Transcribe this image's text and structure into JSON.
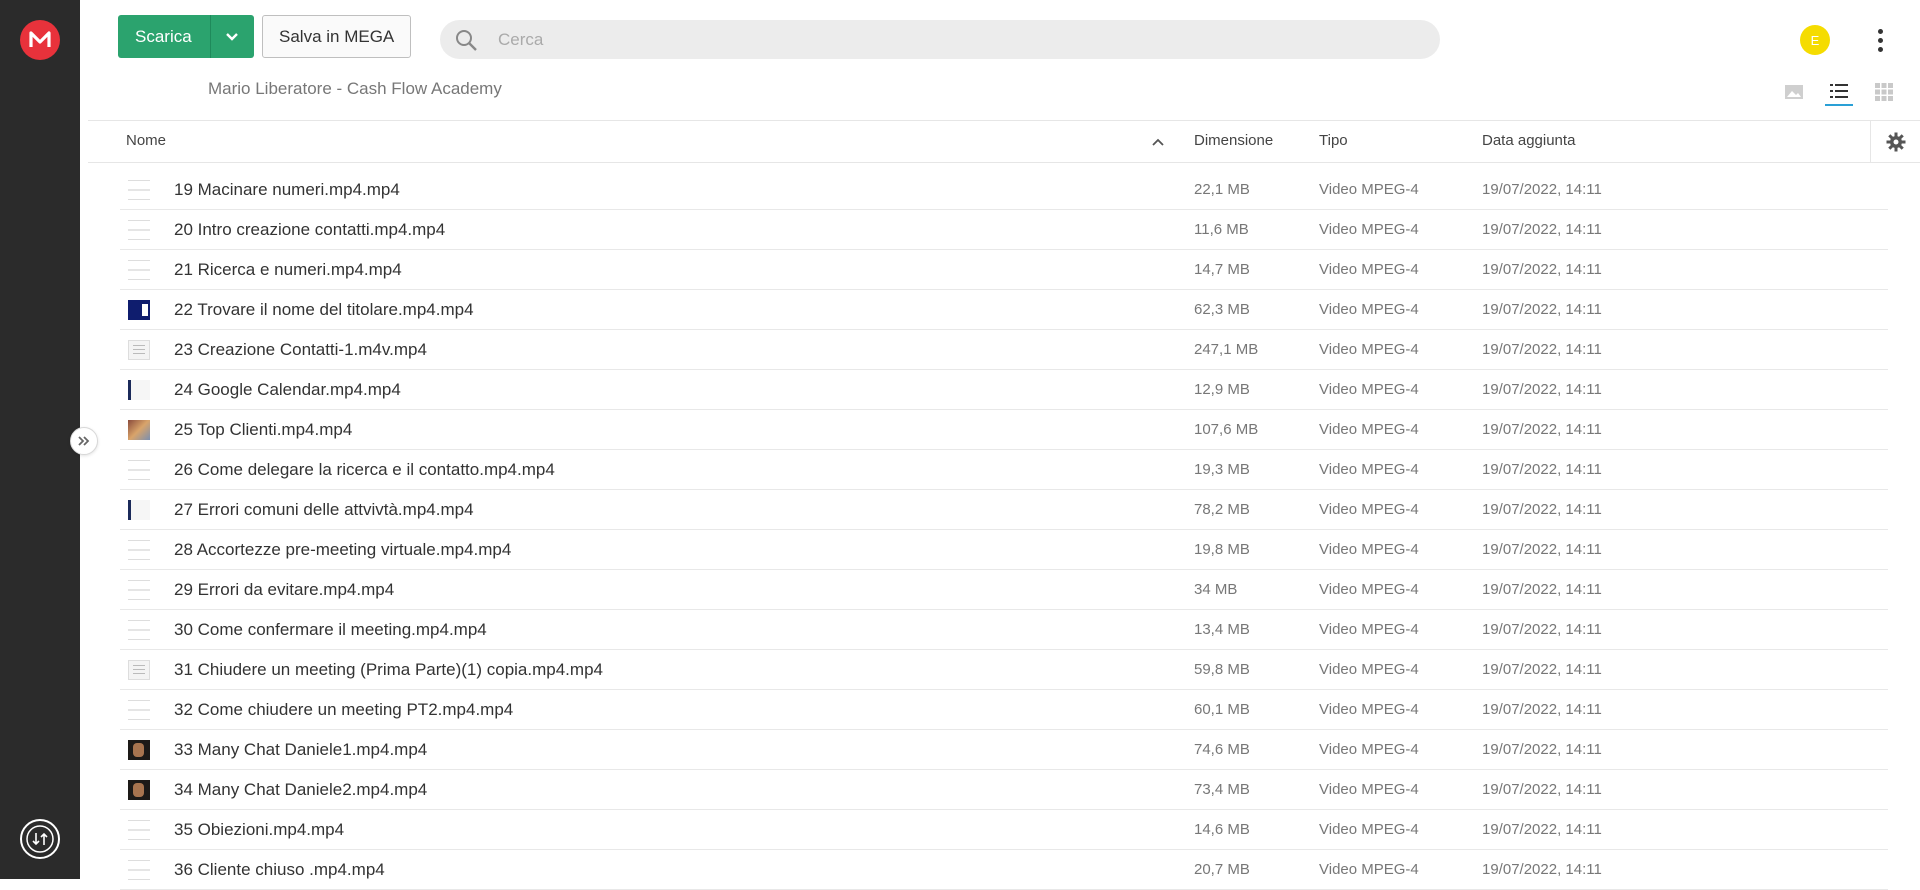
{
  "toolbar": {
    "download_label": "Scarica",
    "save_label": "Salva in MEGA",
    "search_placeholder": "Cerca",
    "avatar_initial": "E"
  },
  "breadcrumb": "Mario Liberatore - Cash Flow Academy",
  "columns": {
    "name": "Nome",
    "size": "Dimensione",
    "type": "Tipo",
    "date": "Data aggiunta"
  },
  "colors": {
    "download_button": "#2ba36e",
    "logo": "#e8323b",
    "avatar": "#f5dc00",
    "sidebar": "#2b2b2b"
  },
  "files": [
    {
      "name": "19 Macinare numeri.mp4.mp4",
      "size": "22,1 MB",
      "type": "Video MPEG-4",
      "date": "19/07/2022, 14:11",
      "thumb": "t-blank"
    },
    {
      "name": "20 Intro creazione contatti.mp4.mp4",
      "size": "11,6 MB",
      "type": "Video MPEG-4",
      "date": "19/07/2022, 14:11",
      "thumb": "t-blank"
    },
    {
      "name": "21 Ricerca e numeri.mp4.mp4",
      "size": "14,7 MB",
      "type": "Video MPEG-4",
      "date": "19/07/2022, 14:11",
      "thumb": "t-blank"
    },
    {
      "name": "22 Trovare il nome del titolare.mp4.mp4",
      "size": "62,3 MB",
      "type": "Video MPEG-4",
      "date": "19/07/2022, 14:11",
      "thumb": "t-navy"
    },
    {
      "name": "23 Creazione Contatti-1.m4v.mp4",
      "size": "247,1 MB",
      "type": "Video MPEG-4",
      "date": "19/07/2022, 14:11",
      "thumb": "t-doc"
    },
    {
      "name": "24 Google Calendar.mp4.mp4",
      "size": "12,9 MB",
      "type": "Video MPEG-4",
      "date": "19/07/2022, 14:11",
      "thumb": "t-bar"
    },
    {
      "name": "25 Top Clienti.mp4.mp4",
      "size": "107,6 MB",
      "type": "Video MPEG-4",
      "date": "19/07/2022, 14:11",
      "thumb": "t-color"
    },
    {
      "name": "26 Come delegare la ricerca e il contatto.mp4.mp4",
      "size": "19,3 MB",
      "type": "Video MPEG-4",
      "date": "19/07/2022, 14:11",
      "thumb": "t-blank"
    },
    {
      "name": "27 Errori comuni delle attvivtà.mp4.mp4",
      "size": "78,2 MB",
      "type": "Video MPEG-4",
      "date": "19/07/2022, 14:11",
      "thumb": "t-bar"
    },
    {
      "name": "28 Accortezze pre-meeting virtuale.mp4.mp4",
      "size": "19,8 MB",
      "type": "Video MPEG-4",
      "date": "19/07/2022, 14:11",
      "thumb": "t-blank"
    },
    {
      "name": "29 Errori da evitare.mp4.mp4",
      "size": "34 MB",
      "type": "Video MPEG-4",
      "date": "19/07/2022, 14:11",
      "thumb": "t-blank"
    },
    {
      "name": "30 Come confermare il meeting.mp4.mp4",
      "size": "13,4 MB",
      "type": "Video MPEG-4",
      "date": "19/07/2022, 14:11",
      "thumb": "t-blank"
    },
    {
      "name": "31 Chiudere un meeting (Prima Parte)(1) copia.mp4.mp4",
      "size": "59,8 MB",
      "type": "Video MPEG-4",
      "date": "19/07/2022, 14:11",
      "thumb": "t-doc"
    },
    {
      "name": "32 Come chiudere un meeting PT2.mp4.mp4",
      "size": "60,1 MB",
      "type": "Video MPEG-4",
      "date": "19/07/2022, 14:11",
      "thumb": "t-blank"
    },
    {
      "name": "33 Many Chat Daniele1.mp4.mp4",
      "size": "74,6 MB",
      "type": "Video MPEG-4",
      "date": "19/07/2022, 14:11",
      "thumb": "t-dark"
    },
    {
      "name": "34 Many Chat Daniele2.mp4.mp4",
      "size": "73,4 MB",
      "type": "Video MPEG-4",
      "date": "19/07/2022, 14:11",
      "thumb": "t-dark"
    },
    {
      "name": "35 Obiezioni.mp4.mp4",
      "size": "14,6 MB",
      "type": "Video MPEG-4",
      "date": "19/07/2022, 14:11",
      "thumb": "t-blank"
    },
    {
      "name": "36 Cliente chiuso .mp4.mp4",
      "size": "20,7 MB",
      "type": "Video MPEG-4",
      "date": "19/07/2022, 14:11",
      "thumb": "t-blank"
    }
  ]
}
